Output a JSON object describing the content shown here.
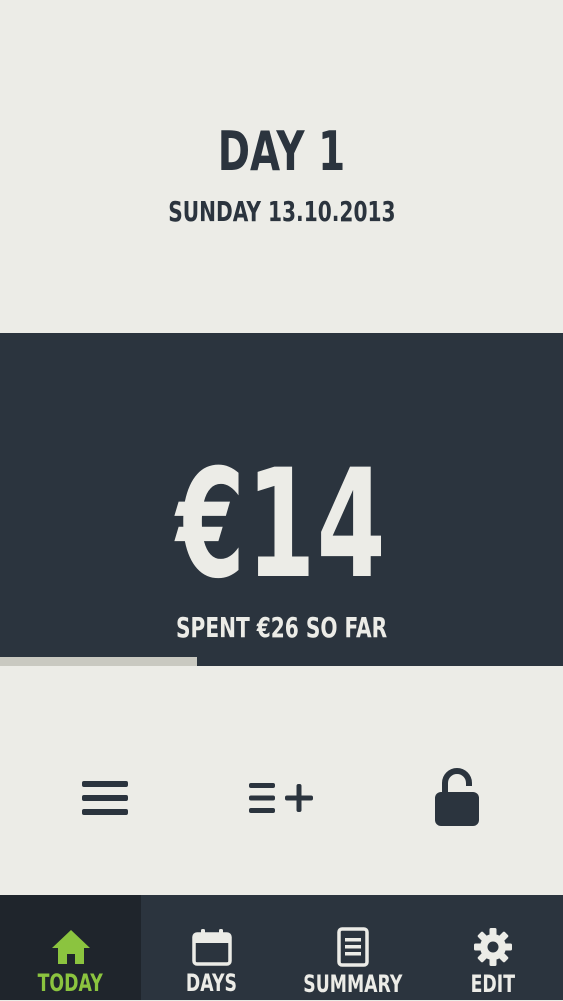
{
  "header": {
    "day_title": "DAY 1",
    "date": "SUNDAY 13.10.2013"
  },
  "budget": {
    "remaining": "€14",
    "spent_text": "SPENT €26 SO FAR",
    "progress_fraction": 0.35
  },
  "actions": [
    {
      "icon": "list-icon"
    },
    {
      "icon": "add-to-list-icon"
    },
    {
      "icon": "padlock-unlocked-icon"
    }
  ],
  "tabs": [
    {
      "label": "TODAY",
      "icon": "home-icon",
      "active": true
    },
    {
      "label": "DAYS",
      "icon": "calendar-icon",
      "active": false
    },
    {
      "label": "SUMMARY",
      "icon": "document-icon",
      "active": false
    },
    {
      "label": "EDIT",
      "icon": "gear-icon",
      "active": false
    }
  ],
  "colors": {
    "background": "#ecece7",
    "dark": "#2b343e",
    "active_tab": "#1f252c",
    "accent_green": "#8bc43f",
    "progress": "#c9c9c1"
  }
}
